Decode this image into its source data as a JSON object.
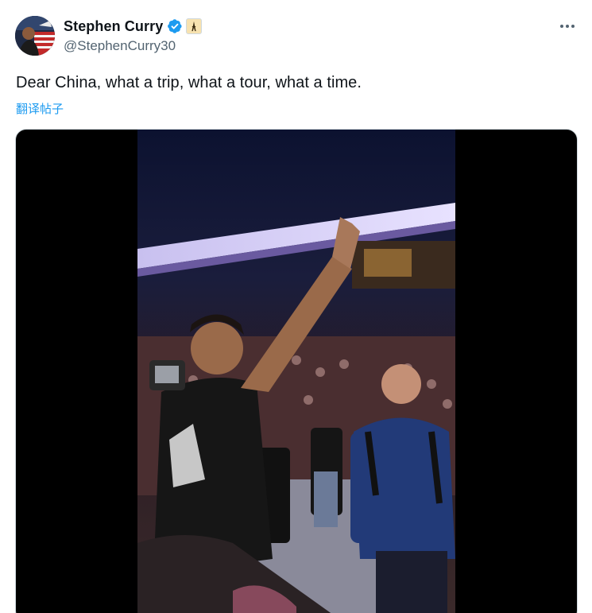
{
  "author": {
    "display_name": "Stephen Curry",
    "handle": "@StephenCurry30",
    "verified_icon": "verified-badge-icon",
    "affiliate_icon": "affiliate-badge-icon"
  },
  "tweet": {
    "text": "Dear China, what a trip, what a tour, what a time.",
    "translate_label": "翻译帖子"
  },
  "colors": {
    "link_blue": "#1d9bf0",
    "text_primary": "#0f1419",
    "text_secondary": "#536471",
    "video_bg": "#000000"
  },
  "icons": {
    "more": "more-options-icon",
    "avatar": "avatar-image"
  }
}
